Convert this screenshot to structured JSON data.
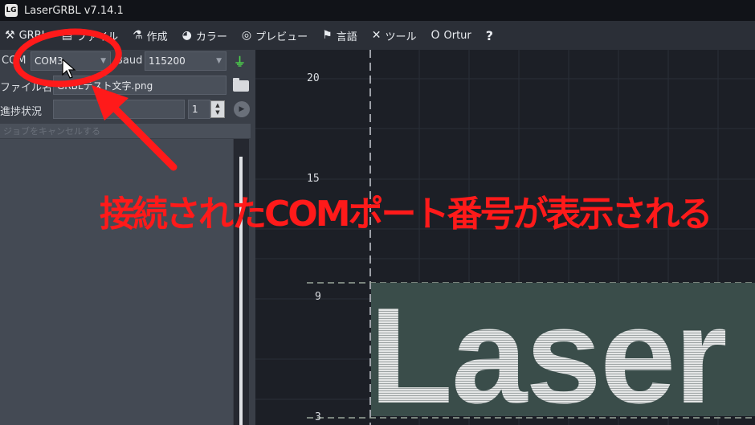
{
  "window": {
    "title": "LaserGRBL v7.14.1"
  },
  "menu": [
    {
      "icon": "wrench-icon",
      "glyph": "⚒",
      "label": "GRBL"
    },
    {
      "icon": "file-icon",
      "glyph": "▤",
      "label": "ファイル"
    },
    {
      "icon": "flask-icon",
      "glyph": "⚗",
      "label": "作成"
    },
    {
      "icon": "palette-icon",
      "glyph": "◕",
      "label": "カラー"
    },
    {
      "icon": "preview-icon",
      "glyph": "◎",
      "label": "プレビュー"
    },
    {
      "icon": "flag-icon",
      "glyph": "⚑",
      "label": "言語"
    },
    {
      "icon": "tools-icon",
      "glyph": "✕",
      "label": "ツール"
    },
    {
      "icon": "ortur-icon",
      "glyph": "O",
      "label": "Ortur"
    },
    {
      "icon": "help-icon",
      "glyph": "",
      "label": "?"
    }
  ],
  "connection": {
    "com_label": "COM",
    "com_value": "COM3",
    "baud_label": "Baud",
    "baud_value": "115200",
    "connect_glyph": "⏚"
  },
  "file": {
    "label": "ファイル名",
    "value": "GRBLテスト文字.png"
  },
  "progress": {
    "label": "進捗状況",
    "count": "1",
    "bar_text": "ジョブをキャンセルする",
    "value": 0
  },
  "canvas": {
    "y_ticks": [
      "20",
      "15",
      "9",
      "3"
    ],
    "engraved_text": "Laser",
    "colors": {
      "background": "#1c1f26",
      "engrave_area": "#3a4d4a"
    }
  },
  "annotation": {
    "text": "接続されたCOMポート番号が表示される",
    "color": "#ff1a1a"
  }
}
